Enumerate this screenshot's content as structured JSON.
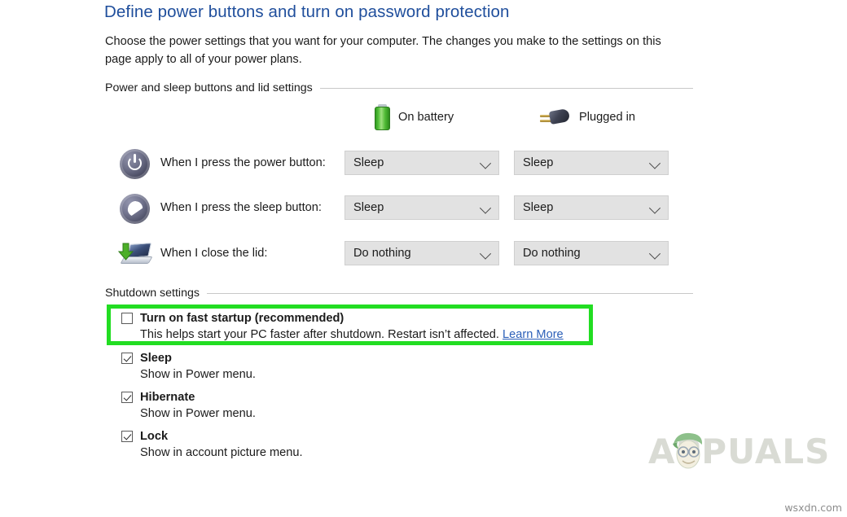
{
  "page": {
    "title": "Define power buttons and turn on password protection",
    "intro": "Choose the power settings that you want for your computer. The changes you make to the settings on this page apply to all of your power plans."
  },
  "sections": {
    "power_sleep": {
      "heading": "Power and sleep buttons and lid settings",
      "columns": [
        {
          "label": "On battery",
          "icon": "battery-icon"
        },
        {
          "label": "Plugged in",
          "icon": "plug-icon"
        }
      ],
      "rows": [
        {
          "icon": "power-button-icon",
          "label": "When I press the power button:",
          "on_battery": "Sleep",
          "plugged_in": "Sleep"
        },
        {
          "icon": "sleep-moon-icon",
          "label": "When I press the sleep button:",
          "on_battery": "Sleep",
          "plugged_in": "Sleep"
        },
        {
          "icon": "laptop-lid-icon",
          "label": "When I close the lid:",
          "on_battery": "Do nothing",
          "plugged_in": "Do nothing"
        }
      ]
    },
    "shutdown": {
      "heading": "Shutdown settings",
      "items": [
        {
          "title": "Turn on fast startup (recommended)",
          "checked": false,
          "description_before_link": "This helps start your PC faster after shutdown. Restart isn’t affected. ",
          "link_text": "Learn More",
          "highlighted": true
        },
        {
          "title": "Sleep",
          "checked": true,
          "description": "Show in Power menu."
        },
        {
          "title": "Hibernate",
          "checked": true,
          "description": "Show in Power menu."
        },
        {
          "title": "Lock",
          "checked": true,
          "description": "Show in account picture menu."
        }
      ]
    }
  },
  "watermarks": {
    "brand": "APPUALS",
    "site": "wsxdn.com"
  },
  "colors": {
    "title_blue": "#1f4e9c",
    "link_blue": "#2b5fb8",
    "highlight_green": "#22dd22",
    "dropdown_bg": "#e2e2e2",
    "rule_gray": "#c8c8c8"
  }
}
